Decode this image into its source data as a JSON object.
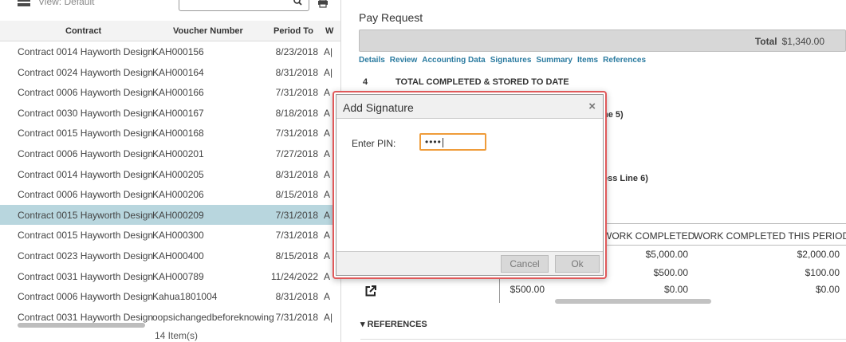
{
  "left": {
    "view_label": "View: Default",
    "columns": {
      "contract": "Contract",
      "voucher": "Voucher Number",
      "period": "Period To",
      "w": "W"
    },
    "rows": [
      {
        "contract": "Contract 0014 Hayworth Design",
        "voucher": "KAH000156",
        "period": "8/23/2018",
        "w": "A|"
      },
      {
        "contract": "Contract 0024 Hayworth Design",
        "voucher": "KAH000164",
        "period": "8/31/2018",
        "w": "A|"
      },
      {
        "contract": "Contract 0006 Hayworth Design",
        "voucher": "KAH000166",
        "period": "7/31/2018",
        "w": "A"
      },
      {
        "contract": "Contract 0030 Hayworth Design",
        "voucher": "KAH000167",
        "period": "8/18/2018",
        "w": "A"
      },
      {
        "contract": "Contract 0015 Hayworth Design",
        "voucher": "KAH000168",
        "period": "7/31/2018",
        "w": "A"
      },
      {
        "contract": "Contract 0006 Hayworth Design",
        "voucher": "KAH000201",
        "period": "7/27/2018",
        "w": "A"
      },
      {
        "contract": "Contract 0014 Hayworth Design",
        "voucher": "KAH000205",
        "period": "8/31/2018",
        "w": "A"
      },
      {
        "contract": "Contract 0006 Hayworth Design",
        "voucher": "KAH000206",
        "period": "8/15/2018",
        "w": "A"
      },
      {
        "contract": "Contract 0015 Hayworth Design",
        "voucher": "KAH000209",
        "period": "7/31/2018",
        "w": "A"
      },
      {
        "contract": "Contract 0015 Hayworth Design",
        "voucher": "KAH000300",
        "period": "7/31/2018",
        "w": "A"
      },
      {
        "contract": "Contract 0023 Hayworth Design",
        "voucher": "KAH000400",
        "period": "8/15/2018",
        "w": "A"
      },
      {
        "contract": "Contract 0031 Hayworth Design",
        "voucher": "KAH000789",
        "period": "11/24/2022",
        "w": "A"
      },
      {
        "contract": "Contract 0006 Hayworth Design",
        "voucher": "Kahua1801004",
        "period": "8/31/2018",
        "w": "A"
      },
      {
        "contract": "Contract 0031 Hayworth Design",
        "voucher": "oopsichangedbeforeknowing",
        "period": "7/31/2018",
        "w": "A|"
      }
    ],
    "selected_index": 8,
    "item_count": "14 Item(s)"
  },
  "right": {
    "title": "Pay Request",
    "total_label": "Total",
    "total_value": "$1,340.00",
    "tabs": [
      "Details",
      "Review",
      "Accounting Data",
      "Signatures",
      "Summary",
      "Items",
      "References"
    ],
    "section_num": "4",
    "section_text": "TOTAL COMPLETED & STORED TO DATE",
    "partial_line5": "ne 5)",
    "partial_line6": "ess Line 6)",
    "grid_headers": [
      "WORK COMPLETED",
      "WORK COMPLETED THIS PERIOD"
    ],
    "grid_rows": [
      {
        "a": "",
        "b": "$5,000.00",
        "c": "$2,000.00"
      },
      {
        "a": "",
        "b": "$500.00",
        "c": "$100.00"
      },
      {
        "a": "$500.00",
        "b": "$0.00",
        "c": "$0.00"
      }
    ],
    "references": "REFERENCES"
  },
  "modal": {
    "title": "Add Signature",
    "close": "×",
    "pin_label": "Enter PIN:",
    "pin_value": "••••",
    "cancel": "Cancel",
    "ok": "Ok"
  },
  "colors": {
    "selected_row": "#b8d6de",
    "tab_link": "#2b7ba0",
    "modal_border": "#e0595a",
    "pin_focus": "#ef9c3a",
    "arrow": "#e64545"
  }
}
